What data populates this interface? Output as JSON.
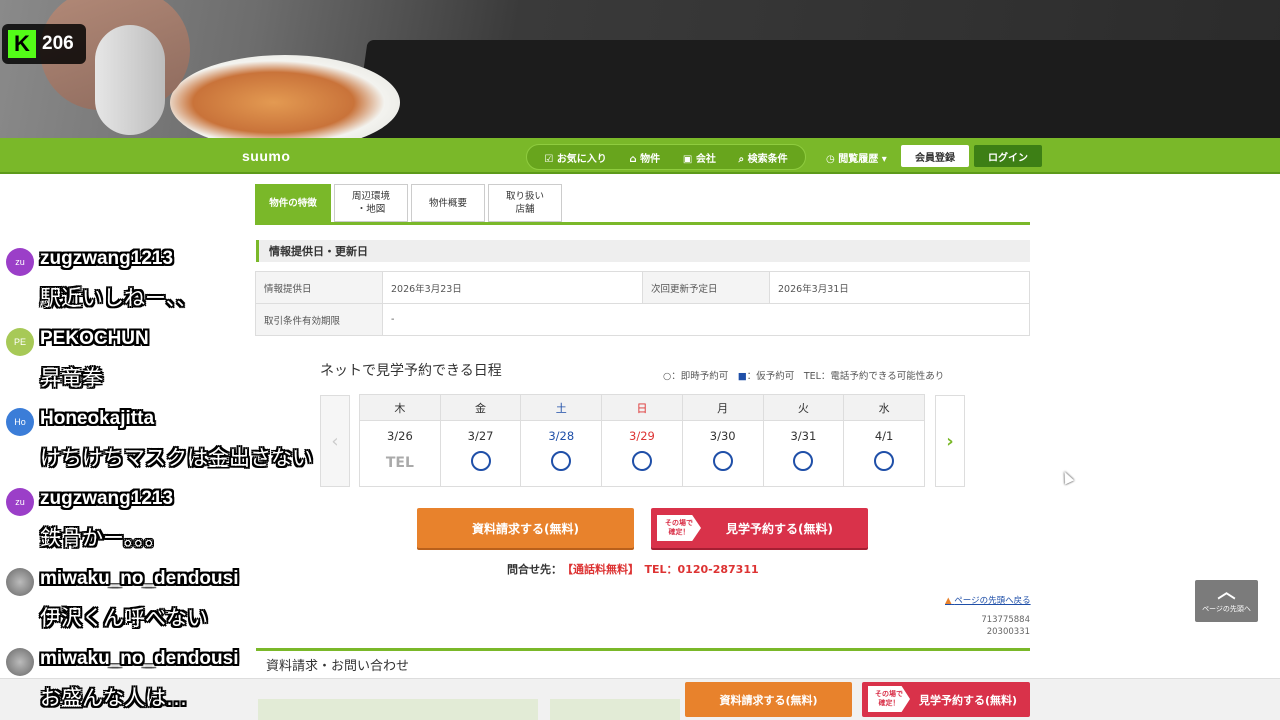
{
  "stream": {
    "viewer_count": "206",
    "platform_icon": "k-logo-icon",
    "platform_color": "#53fc18"
  },
  "header": {
    "logo": "suumo",
    "nav": [
      "お気に入り",
      "物件",
      "会社",
      "検索条件"
    ],
    "history": "閲覧履歴 ▾",
    "register": "会員登録",
    "login": "ログイン",
    "color": "#7ab829"
  },
  "tabs": [
    {
      "label": "物件の特徴"
    },
    {
      "label": "周辺環境\n・地図"
    },
    {
      "label": "物件概要"
    },
    {
      "label": "取り扱い\n店舗"
    }
  ],
  "info_section": {
    "title": "情報提供日・更新日",
    "rows": [
      {
        "k1": "情報提供日",
        "v1": "2026年3月23日",
        "k2": "次回更新予定日",
        "v2": "2026年3月31日"
      },
      {
        "k1": "取引条件有効期限",
        "v1": "-"
      }
    ]
  },
  "schedule": {
    "title": "ネットで見学予約できる日程",
    "legend": {
      "circle": "○：即時予約可",
      "square": "■",
      "square_text": "：仮予約可",
      "tel": "TEL：電話予約できる可能性あり"
    },
    "days": [
      "木",
      "金",
      "土",
      "日",
      "月",
      "火",
      "水"
    ],
    "dates": [
      "3/26",
      "3/27",
      "3/28",
      "3/29",
      "3/30",
      "3/31",
      "4/1"
    ],
    "status": [
      "TEL",
      "○",
      "○",
      "○",
      "○",
      "○",
      "○"
    ]
  },
  "cta": {
    "request": "資料請求する(無料)",
    "visit": "見学予約する(無料)",
    "badge": "その場で\n確定！"
  },
  "contact": {
    "label": "問合せ先：",
    "free": "【通話料無料】",
    "tel": "TEL：0120-287311"
  },
  "page_top_link": "ページの先頭へ戻る",
  "codes": [
    "713775884",
    "20300331"
  ],
  "section2_title": "資料請求・お問い合わせ",
  "page_top_button": "ページの先頭へ",
  "chat": [
    {
      "user": "zugzwang1213",
      "avatar": "zu",
      "color": "#9b3fc8",
      "text": "駅近いしねー、、"
    },
    {
      "user": "PEKOCHUN",
      "avatar": "PE",
      "color": "#a7c957",
      "text": "昇竜拳"
    },
    {
      "user": "Honeokajitta",
      "avatar": "Ho",
      "color": "#3b7dd8",
      "text": "けちけちマスクは金出さない"
    },
    {
      "user": "zugzwang1213",
      "avatar": "zu",
      "color": "#9b3fc8",
      "text": "鉄骨かー。。。"
    },
    {
      "user": "miwaku_no_dendousi",
      "avatar": "",
      "color": "#888888",
      "text": "伊沢くん呼べない"
    },
    {
      "user": "miwaku_no_dendousi",
      "avatar": "",
      "color": "#888888",
      "text": "お盛んな人は…"
    }
  ]
}
